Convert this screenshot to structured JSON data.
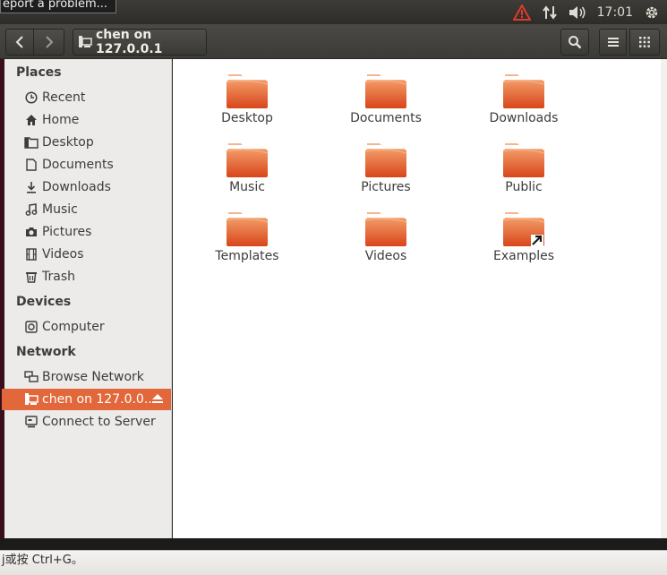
{
  "system_panel": {
    "tooltip": "eport a problem...",
    "clock": "17:01",
    "icons": [
      "warning-icon",
      "network-icon",
      "volume-icon",
      "settings-gear-icon"
    ]
  },
  "header": {
    "path_label": "chen on 127.0.0.1",
    "icons": [
      "back-icon",
      "forward-icon",
      "network-share-icon",
      "search-icon",
      "list-view-icon",
      "grid-view-icon"
    ]
  },
  "sidebar": {
    "places_heading": "Places",
    "places": [
      {
        "label": "Recent",
        "icon": "clock-icon"
      },
      {
        "label": "Home",
        "icon": "home-icon"
      },
      {
        "label": "Desktop",
        "icon": "folder-icon"
      },
      {
        "label": "Documents",
        "icon": "document-icon"
      },
      {
        "label": "Downloads",
        "icon": "download-icon"
      },
      {
        "label": "Music",
        "icon": "music-icon"
      },
      {
        "label": "Pictures",
        "icon": "camera-icon"
      },
      {
        "label": "Videos",
        "icon": "film-icon"
      },
      {
        "label": "Trash",
        "icon": "trash-icon"
      }
    ],
    "devices_heading": "Devices",
    "devices": [
      {
        "label": "Computer",
        "icon": "computer-icon"
      }
    ],
    "network_heading": "Network",
    "network": [
      {
        "label": "Browse Network",
        "icon": "network-icon"
      },
      {
        "label": "chen on 127.0.0....",
        "icon": "network-share-icon",
        "active": true
      },
      {
        "label": "Connect to Server",
        "icon": "server-icon"
      }
    ]
  },
  "files": [
    {
      "label": "Desktop"
    },
    {
      "label": "Documents"
    },
    {
      "label": "Downloads"
    },
    {
      "label": "Music"
    },
    {
      "label": "Pictures"
    },
    {
      "label": "Public"
    },
    {
      "label": "Templates"
    },
    {
      "label": "Videos"
    },
    {
      "label": "Examples",
      "symlink": true
    }
  ],
  "status": {
    "text": "j或按 Ctrl+G。"
  },
  "colors": {
    "accent": "#e2683b",
    "folder_top": "#f4a06e",
    "folder_body": "#d94a16"
  }
}
